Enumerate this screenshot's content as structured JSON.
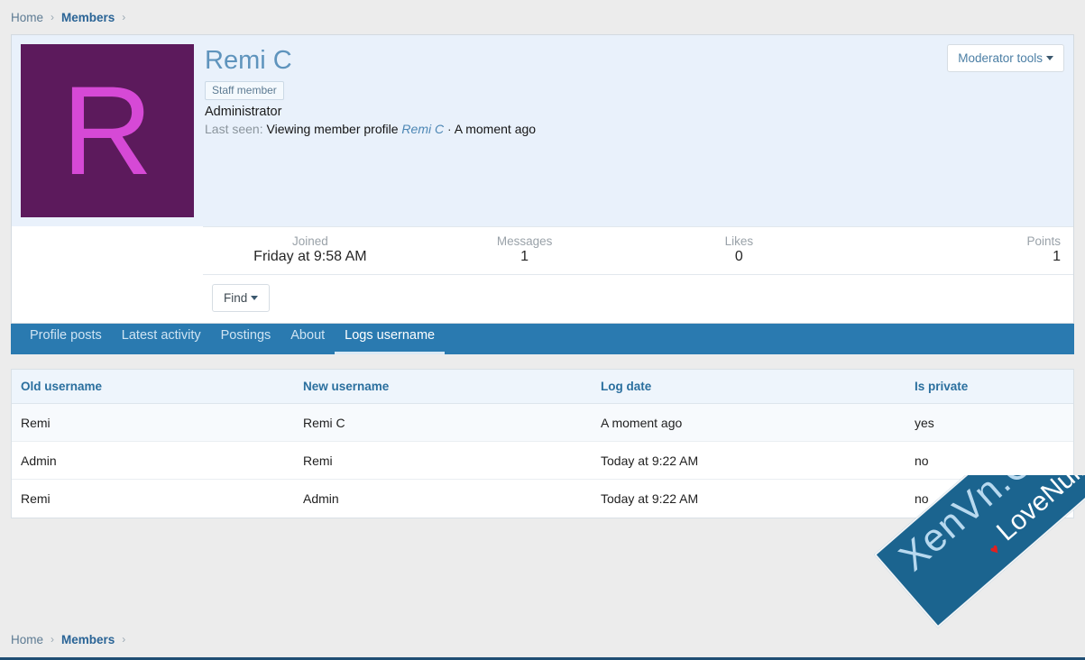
{
  "breadcrumb": {
    "home": "Home",
    "members": "Members",
    "separator": "›"
  },
  "profile": {
    "avatar_letter": "R",
    "avatar_bg": "#5c1a5c",
    "avatar_fg": "#d649d6",
    "username": "Remi C",
    "staff_badge": "Staff member",
    "user_title": "Administrator",
    "last_seen_label": "Last seen:",
    "last_seen_action": "Viewing member profile",
    "last_seen_link": "Remi C",
    "last_seen_dot": "·",
    "last_seen_time": "A moment ago",
    "moderator_tools": "Moderator tools",
    "find_button": "Find"
  },
  "stats": [
    {
      "label": "Joined",
      "value": "Friday at 9:58 AM"
    },
    {
      "label": "Messages",
      "value": "1"
    },
    {
      "label": "Likes",
      "value": "0"
    },
    {
      "label": "Points",
      "value": "1"
    }
  ],
  "tabs": [
    {
      "label": "Profile posts",
      "active": false
    },
    {
      "label": "Latest activity",
      "active": false
    },
    {
      "label": "Postings",
      "active": false
    },
    {
      "label": "About",
      "active": false
    },
    {
      "label": "Logs username",
      "active": true
    }
  ],
  "table": {
    "headers": [
      "Old username",
      "New username",
      "Log date",
      "Is private"
    ],
    "rows": [
      {
        "old_username": "Remi",
        "new_username": "Remi C",
        "log_date": "A moment ago",
        "is_private": "yes"
      },
      {
        "old_username": "Admin",
        "new_username": "Remi",
        "log_date": "Today at 9:22 AM",
        "is_private": "no"
      },
      {
        "old_username": "Remi",
        "new_username": "Admin",
        "log_date": "Today at 9:22 AM",
        "is_private": "no"
      }
    ]
  },
  "watermark": {
    "primary": "XenVn.Com",
    "secondary": "LoveNulled.com",
    "heart": "♥",
    "band_color": "#1b648f"
  },
  "colors": {
    "tabbar": "#2a7ab0",
    "header_bg": "#e9f1fb",
    "page_bg": "#ececec"
  }
}
